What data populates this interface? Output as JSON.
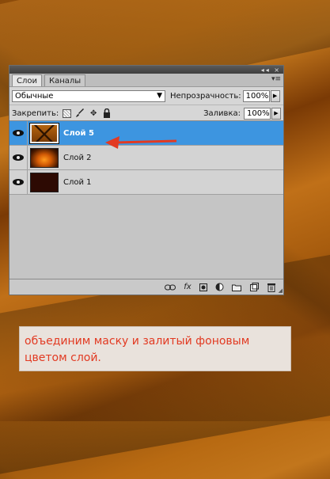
{
  "panel": {
    "tabs": [
      {
        "label": "Слои",
        "active": true
      },
      {
        "label": "Каналы",
        "active": false
      }
    ],
    "titlebar_controls": "◂◂ ×",
    "menu_glyph": "▾≡"
  },
  "options": {
    "blend_mode": "Обычные",
    "opacity_label": "Непрозрачность:",
    "opacity_value": "100%",
    "lock_label": "Закрепить:",
    "fill_label": "Заливка:",
    "fill_value": "100%"
  },
  "layers": [
    {
      "name": "Слой 5",
      "selected": true,
      "visible": true
    },
    {
      "name": "Слой 2",
      "selected": false,
      "visible": true
    },
    {
      "name": "Слой 1",
      "selected": false,
      "visible": true
    }
  ],
  "bottom_icons": [
    "link-icon",
    "fx-icon",
    "mask-icon",
    "adjustment-icon",
    "folder-icon",
    "new-layer-icon",
    "trash-icon"
  ],
  "fx_label": "fx",
  "caption": "объединим маску и залитый фоновым цветом слой.",
  "colors": {
    "selection": "#3d95e0",
    "arrow": "#e23a22",
    "caption_text": "#e23a22"
  }
}
